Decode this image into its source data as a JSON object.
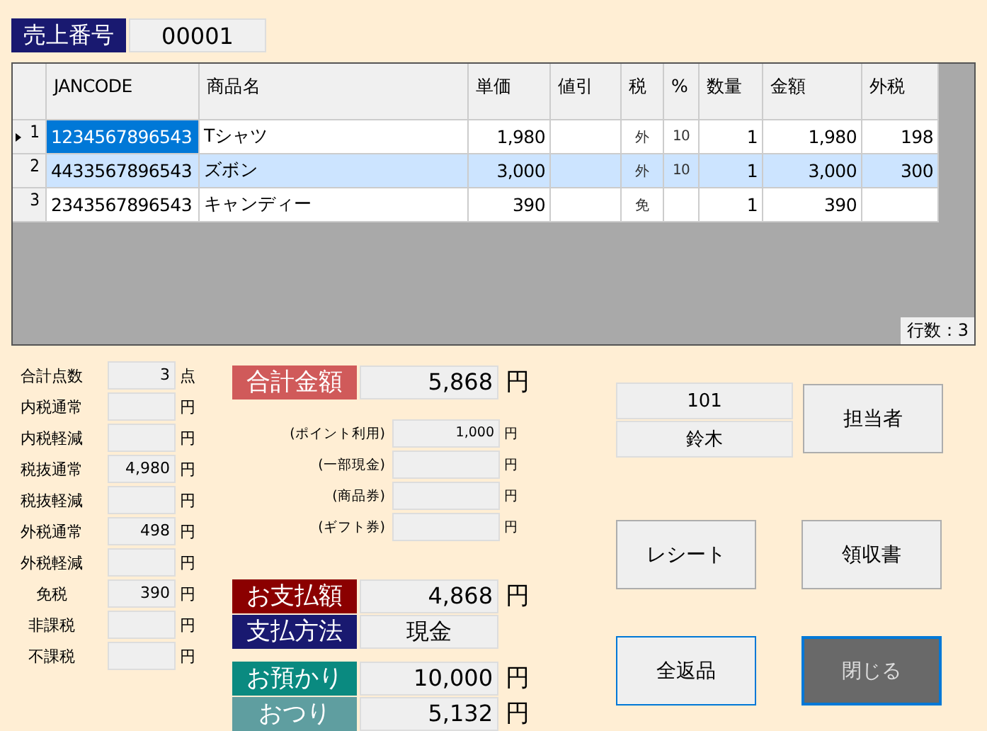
{
  "sale_number": {
    "label": "売上番号",
    "value": "00001"
  },
  "table": {
    "columns": [
      "JANCODE",
      "商品名",
      "単価",
      "値引",
      "税",
      "%",
      "数量",
      "金額",
      "外税"
    ],
    "rows": [
      {
        "number": "1",
        "current": true,
        "selected": false,
        "cells": [
          "1234567896543",
          "Tシャツ",
          "1,980",
          "",
          "外",
          "10",
          "1",
          "1,980",
          "198"
        ]
      },
      {
        "number": "2",
        "current": false,
        "selected": true,
        "cells": [
          "4433567896543",
          "ズボン",
          "3,000",
          "",
          "外",
          "10",
          "1",
          "3,000",
          "300"
        ]
      },
      {
        "number": "3",
        "current": false,
        "selected": false,
        "cells": [
          "2343567896543",
          "キャンディー",
          "390",
          "",
          "免",
          "",
          "1",
          "390",
          ""
        ]
      }
    ],
    "row_count": "行数：3"
  },
  "breakdown": [
    {
      "label": "合計点数",
      "value": "3",
      "unit": "点"
    },
    {
      "label": "内税通常",
      "unit": "円"
    },
    {
      "label": "内税軽減",
      "unit": "円"
    },
    {
      "label": "税抜通常",
      "value": "4,980",
      "unit": "円"
    },
    {
      "label": "税抜軽減",
      "unit": "円"
    },
    {
      "label": "外税通常",
      "value": "498",
      "unit": "円"
    },
    {
      "label": "外税軽減",
      "unit": "円"
    },
    {
      "label": "免税",
      "value": "390",
      "unit": "円"
    },
    {
      "label": "非課税",
      "unit": "円"
    },
    {
      "label": "不課税",
      "unit": "円"
    }
  ],
  "total": {
    "label": "合計金額",
    "value": "5,868",
    "unit": "円",
    "color": "#d05a5a"
  },
  "deductions": [
    {
      "label": "(ポイント利用)",
      "value": "1,000",
      "unit": "円"
    },
    {
      "label": "(一部現金)",
      "unit": "円"
    },
    {
      "label": "(商品券)",
      "unit": "円"
    },
    {
      "label": "(ギフト券)",
      "unit": "円"
    }
  ],
  "payment": [
    {
      "label": "お支払額",
      "value": "4,868",
      "unit": "円",
      "color": "#8b0000"
    },
    {
      "label": "支払方法",
      "value": "現金",
      "color": "#191970"
    }
  ],
  "cash": [
    {
      "label": "お預かり",
      "value": "10,000",
      "unit": "円",
      "color": "#0a8a80"
    },
    {
      "label": "おつり",
      "value": "5,132",
      "unit": "円",
      "color": "#5f9ea0"
    }
  ],
  "staff": {
    "code": "101",
    "name": "鈴木",
    "button": "担当者"
  },
  "buttons": [
    {
      "label": "レシート",
      "kind": "normal",
      "focused": false
    },
    {
      "label": "領収書",
      "kind": "normal",
      "focused": false
    },
    {
      "label": "全返品",
      "kind": "normal",
      "focused": true
    },
    {
      "label": "閉じる",
      "kind": "dark",
      "focused": true
    }
  ]
}
